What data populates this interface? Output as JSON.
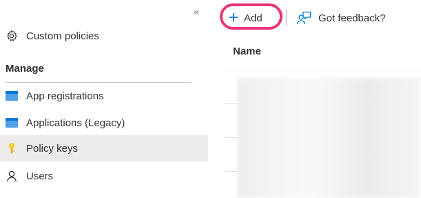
{
  "sidebar": {
    "collapse_glyph": "«",
    "top_item": {
      "label": "Custom policies",
      "icon": "gear-icon"
    },
    "section_title": "Manage",
    "items": [
      {
        "label": "App registrations",
        "icon": "app-registrations-icon"
      },
      {
        "label": "Applications (Legacy)",
        "icon": "applications-icon"
      },
      {
        "label": "Policy keys",
        "icon": "key-icon",
        "selected": true
      },
      {
        "label": "Users",
        "icon": "user-icon"
      }
    ]
  },
  "toolbar": {
    "add_label": "Add",
    "add_glyph": "+",
    "feedback_label": "Got feedback?"
  },
  "table": {
    "columns": [
      "Name"
    ]
  },
  "colors": {
    "accent": "#0078d4",
    "highlight_ring": "#e8357a",
    "key": "#f2c811",
    "selected_bg": "#edebe9"
  }
}
